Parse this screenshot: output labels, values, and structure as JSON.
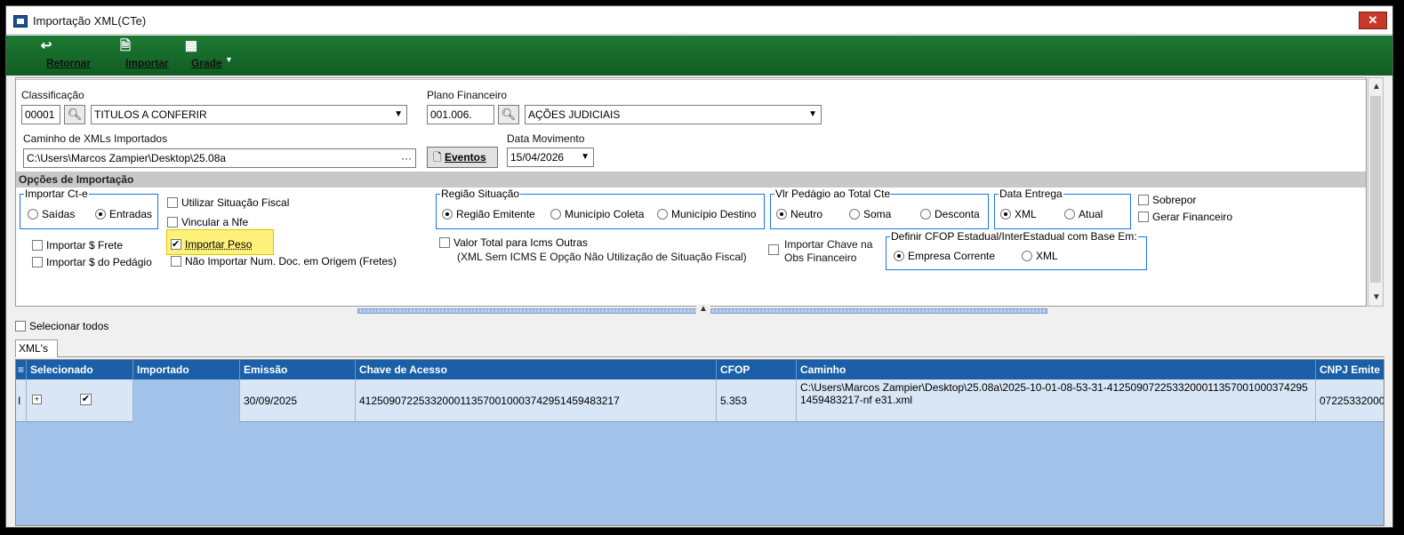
{
  "window": {
    "title": "Importação XML(CTe)",
    "close_label": "✕"
  },
  "toolbar": {
    "retornar": "Retornar",
    "importar": "Importar",
    "grade": "Grade"
  },
  "form": {
    "classificacao": {
      "label": "Classificação",
      "code": "00001",
      "value": "TITULOS A CONFERIR"
    },
    "plano_financeiro": {
      "label": "Plano Financeiro",
      "code": "001.006.",
      "value": "AÇÕES JUDICIAIS"
    },
    "caminho": {
      "label": "Caminho de XMLs Importados",
      "value": "C:\\Users\\Marcos Zampier\\Desktop\\25.08a",
      "ellipsis": "···"
    },
    "eventos_button": "Eventos",
    "data_movimento": {
      "label": "Data Movimento",
      "value": "15/04/2026"
    }
  },
  "opcoes": {
    "title": "Opções de Importação",
    "importar_cte": {
      "title": "Importar Ct-e",
      "saidas": "Saídas",
      "entradas": "Entradas",
      "selected": "entradas"
    },
    "utilizar_situacao_fiscal": "Utilizar Situação Fiscal",
    "vincular_nfe": "Vincular a Nfe",
    "importar_frete": "Importar $ Frete",
    "importar_pedagio": "Importar $ do Pedágio",
    "importar_peso": "Importar Peso",
    "nao_importar_num": "Não Importar Num. Doc. em Origem (Fretes)",
    "regiao_situacao": {
      "title": "Região Situação",
      "opt1": "Região Emitente",
      "opt2": "Município Coleta",
      "opt3": "Município Destino",
      "selected": "opt1"
    },
    "valor_total": "Valor Total para Icms Outras",
    "valor_total_note": "(XML Sem ICMS E Opção Não Utilização de Situação Fiscal)",
    "vlr_pedagio": {
      "title": "Vlr Pedágio ao Total Cte",
      "opt1": "Neutro",
      "opt2": "Soma",
      "opt3": "Desconta",
      "selected": "opt1"
    },
    "importar_chave": "Importar Chave na",
    "importar_chave_2": "Obs Financeiro",
    "data_entrega": {
      "title": "Data Entrega",
      "opt1": "XML",
      "opt2": "Atual",
      "selected": "opt1"
    },
    "sobrepor": "Sobrepor",
    "gerar_financeiro": "Gerar Financeiro",
    "definir_cfop": {
      "title": "Definir CFOP Estadual/InterEstadual com Base Em:",
      "opt1": "Empresa Corrente",
      "opt2": "XML",
      "selected": "opt1"
    }
  },
  "selecionar_todos": "Selecionar todos",
  "tab": "XML's",
  "grid": {
    "columns": [
      "Selecionado",
      "Importado",
      "Emissão",
      "Chave de Acesso",
      "CFOP",
      "Caminho",
      "CNPJ Emite"
    ],
    "rows": [
      {
        "indicator": "I",
        "expand": "+",
        "selecionado": true,
        "importado": "",
        "emissao": "30/09/2025",
        "chave": "41250907225332000113570010003742951459483217",
        "cfop": "5.353",
        "caminho": "C:\\Users\\Marcos Zampier\\Desktop\\25.08a\\2025-10-01-08-53-31-41250907225332000113570010003742951459483217-nf e31.xml",
        "cnpj": "07225332000"
      }
    ]
  },
  "colors": {
    "toolbar": "#0f5c22",
    "grid_header": "#1a5fa8",
    "grid_bg": "#a3c3ea",
    "highlight": "#fff27a",
    "group_border": "#1a73e8"
  }
}
